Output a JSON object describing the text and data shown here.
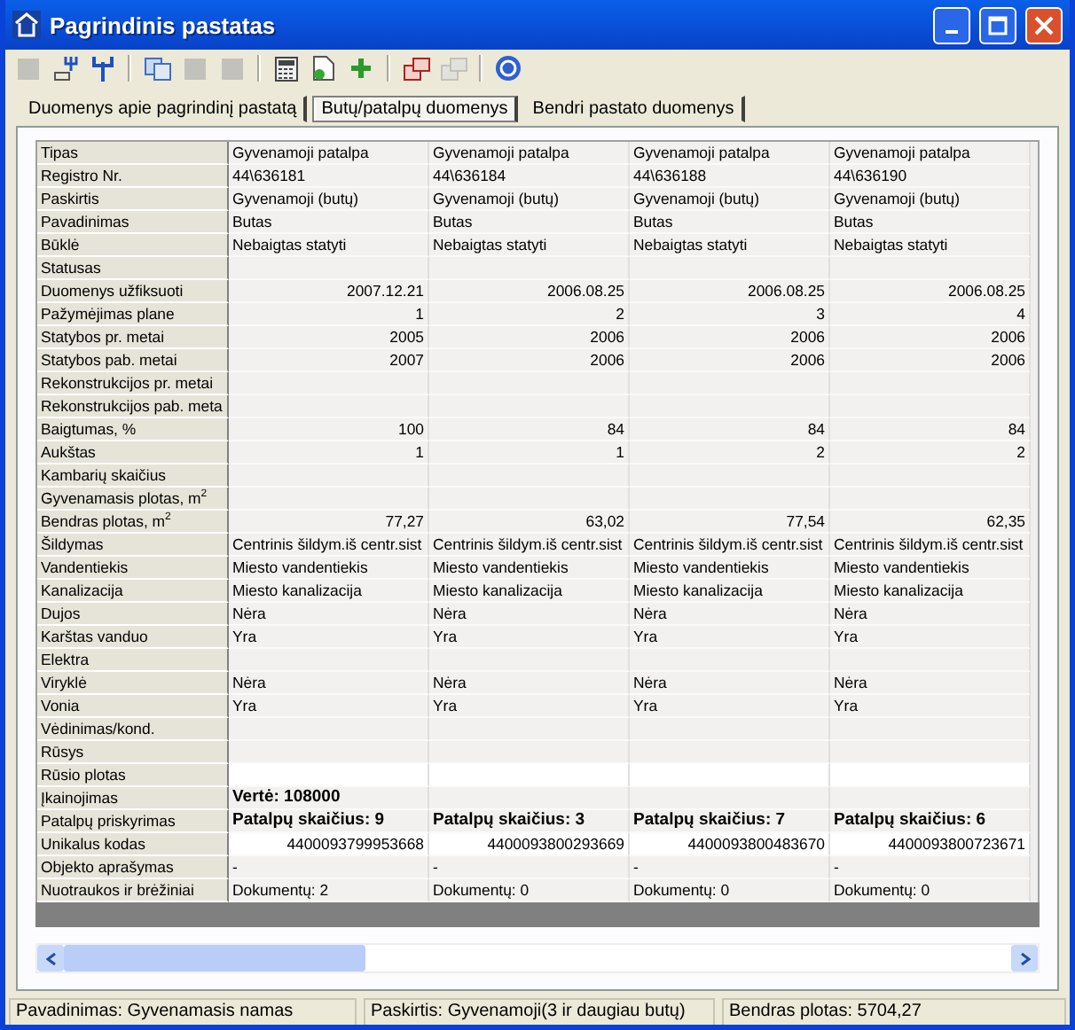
{
  "window": {
    "title": "Pagrindinis pastatas"
  },
  "toolbar": [
    {
      "kind": "square",
      "disabled": true
    },
    {
      "kind": "fork-table",
      "disabled": false
    },
    {
      "kind": "fork",
      "disabled": false
    },
    {
      "kind": "sep"
    },
    {
      "kind": "copy",
      "disabled": false
    },
    {
      "kind": "square",
      "disabled": true
    },
    {
      "kind": "square",
      "disabled": true
    },
    {
      "kind": "sep"
    },
    {
      "kind": "calc",
      "disabled": false
    },
    {
      "kind": "doc",
      "disabled": false
    },
    {
      "kind": "plus",
      "disabled": false
    },
    {
      "kind": "sep"
    },
    {
      "kind": "windows",
      "disabled": false
    },
    {
      "kind": "windows",
      "disabled": true
    },
    {
      "kind": "sep"
    },
    {
      "kind": "help",
      "disabled": false
    }
  ],
  "tabs": [
    {
      "label": "Duomenys apie pagrindinį pastatą",
      "selected": false
    },
    {
      "label": "Butų/patalpų duomenys",
      "selected": true
    },
    {
      "label": "Bendri pastato duomenys",
      "selected": false
    }
  ],
  "table": {
    "rows": [
      {
        "label": "Tipas",
        "kind": "text",
        "values": [
          "Gyvenamoji patalpa",
          "Gyvenamoji patalpa",
          "Gyvenamoji patalpa",
          "Gyvenamoji patalpa"
        ]
      },
      {
        "label": "Registro Nr.",
        "kind": "text",
        "values": [
          "44\\636181",
          "44\\636184",
          "44\\636188",
          "44\\636190"
        ]
      },
      {
        "label": "Paskirtis",
        "kind": "text",
        "values": [
          "Gyvenamoji (butų)",
          "Gyvenamoji (butų)",
          "Gyvenamoji (butų)",
          "Gyvenamoji (butų)"
        ]
      },
      {
        "label": "Pavadinimas",
        "kind": "text",
        "values": [
          "Butas",
          "Butas",
          "Butas",
          "Butas"
        ]
      },
      {
        "label": "Būklė",
        "kind": "text",
        "values": [
          "Nebaigtas statyti",
          "Nebaigtas statyti",
          "Nebaigtas statyti",
          "Nebaigtas statyti"
        ]
      },
      {
        "label": "Statusas",
        "kind": "text"
      },
      {
        "label": "Duomenys užfiksuoti",
        "kind": "number",
        "values": [
          "2007.12.21",
          "2006.08.25",
          "2006.08.25",
          "2006.08.25"
        ]
      },
      {
        "label": "Pažymėjimas plane",
        "kind": "number",
        "values": [
          "1",
          "2",
          "3",
          "4"
        ]
      },
      {
        "label": "Statybos pr. metai",
        "kind": "number",
        "values": [
          "2005",
          "2006",
          "2006",
          "2006"
        ]
      },
      {
        "label": "Statybos pab. metai",
        "kind": "number",
        "values": [
          "2007",
          "2006",
          "2006",
          "2006"
        ]
      },
      {
        "label": "Rekonstrukcijos pr. metai",
        "kind": "number"
      },
      {
        "label": "Rekonstrukcijos pab. meta",
        "kind": "number"
      },
      {
        "label": "Baigtumas, %",
        "kind": "number",
        "values": [
          "100",
          "84",
          "84",
          "84"
        ]
      },
      {
        "label": "Aukštas",
        "kind": "number",
        "values": [
          "1",
          "1",
          "2",
          "2"
        ]
      },
      {
        "label": "Kambarių skaičius",
        "kind": "number"
      },
      {
        "label": "Gyvenamasis plotas, m$^{2}$",
        "kind": "number"
      },
      {
        "label": "Bendras plotas, m$^{2}$",
        "kind": "number",
        "values": [
          "77,27",
          "63,02",
          "77,54",
          "62,35"
        ]
      },
      {
        "label": "Šildymas",
        "kind": "text",
        "values": [
          "Centrinis šildym.iš centr.sist",
          "Centrinis šildym.iš centr.sist",
          "Centrinis šildym.iš centr.sist",
          "Centrinis šildym.iš centr.sist"
        ]
      },
      {
        "label": "Vandentiekis",
        "kind": "text",
        "values": [
          "Miesto vandentiekis",
          "Miesto vandentiekis",
          "Miesto vandentiekis",
          "Miesto vandentiekis"
        ]
      },
      {
        "label": "Kanalizacija",
        "kind": "text",
        "values": [
          "Miesto kanalizacija",
          "Miesto kanalizacija",
          "Miesto kanalizacija",
          "Miesto kanalizacija"
        ]
      },
      {
        "label": "Dujos",
        "kind": "text",
        "values": [
          "Nėra",
          "Nėra",
          "Nėra",
          "Nėra"
        ]
      },
      {
        "label": "Karštas vanduo",
        "kind": "text",
        "values": [
          "Yra",
          "Yra",
          "Yra",
          "Yra"
        ]
      },
      {
        "label": "Elektra",
        "kind": "text"
      },
      {
        "label": "Viryklė",
        "kind": "text",
        "values": [
          "Nėra",
          "Nėra",
          "Nėra",
          "Nėra"
        ]
      },
      {
        "label": "Vonia",
        "kind": "text",
        "values": [
          "Yra",
          "Yra",
          "Yra",
          "Yra"
        ]
      },
      {
        "label": "Vėdinimas/kond.",
        "kind": "text"
      },
      {
        "label": "Rūsys",
        "kind": "text"
      },
      {
        "label": "Rūsio plotas",
        "kind": "code"
      },
      {
        "label": "Įkainojimas",
        "kind": "summary",
        "values": [
          "Vertė: 108000"
        ]
      },
      {
        "label": "Patalpų priskyrimas",
        "kind": "summary",
        "values": [
          "Patalpų skaičius: 9",
          "Patalpų skaičius: 3",
          "Patalpų skaičius: 7",
          "Patalpų skaičius: 6"
        ]
      },
      {
        "label": "Unikalus kodas",
        "kind": "code",
        "values": [
          "4400093799953668",
          "4400093800293669",
          "4400093800483670",
          "4400093800723671"
        ]
      },
      {
        "label": "Objekto aprašymas",
        "kind": "text",
        "values": [
          "-",
          "-",
          "-",
          "-"
        ]
      },
      {
        "label": "Nuotraukos ir brėžiniai",
        "kind": "text",
        "values": [
          "Dokumentų: 2",
          "Dokumentų: 0",
          "Dokumentų: 0",
          "Dokumentų: 0"
        ]
      }
    ]
  },
  "status_bar": [
    "Pavadinimas: Gyvenamasis namas",
    "Paskirtis: Gyvenamoji(3 ir daugiau butų)",
    "Bendras plotas: 5704,27"
  ]
}
